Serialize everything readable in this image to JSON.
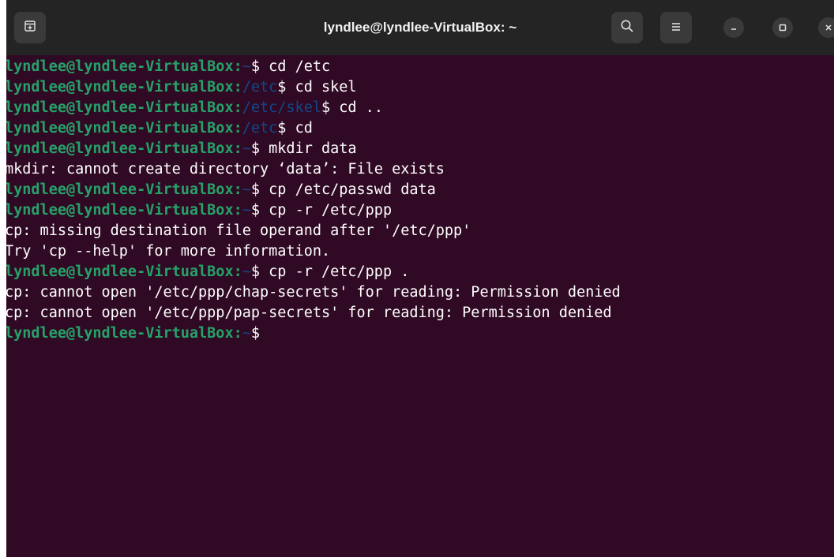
{
  "window": {
    "title": "lyndlee@lyndlee-VirtualBox: ~"
  },
  "icons": {
    "new_tab": "new-tab-icon",
    "search": "search-icon",
    "menu": "hamburger-menu-icon",
    "minimize": "minimize-icon",
    "maximize": "maximize-icon",
    "close": "close-icon"
  },
  "colors": {
    "terminal_bg": "#300a24",
    "titlebar_bg": "#242424",
    "prompt_user": "#26a269",
    "prompt_path": "#12488b",
    "text": "#ffffff"
  },
  "terminal": {
    "lines": [
      {
        "type": "cmd",
        "user": "lyndlee@lyndlee-VirtualBox",
        "sep": ":",
        "path": "~",
        "dollar": "$ ",
        "cmd": "cd /etc"
      },
      {
        "type": "cmd",
        "user": "lyndlee@lyndlee-VirtualBox",
        "sep": ":",
        "path": "/etc",
        "dollar": "$ ",
        "cmd": "cd skel"
      },
      {
        "type": "cmd",
        "user": "lyndlee@lyndlee-VirtualBox",
        "sep": ":",
        "path": "/etc/skel",
        "dollar": "$ ",
        "cmd": "cd .."
      },
      {
        "type": "cmd",
        "user": "lyndlee@lyndlee-VirtualBox",
        "sep": ":",
        "path": "/etc",
        "dollar": "$ ",
        "cmd": "cd"
      },
      {
        "type": "cmd",
        "user": "lyndlee@lyndlee-VirtualBox",
        "sep": ":",
        "path": "~",
        "dollar": "$ ",
        "cmd": "mkdir data"
      },
      {
        "type": "out",
        "text": "mkdir: cannot create directory ‘data’: File exists"
      },
      {
        "type": "cmd",
        "user": "lyndlee@lyndlee-VirtualBox",
        "sep": ":",
        "path": "~",
        "dollar": "$ ",
        "cmd": "cp /etc/passwd data"
      },
      {
        "type": "cmd",
        "user": "lyndlee@lyndlee-VirtualBox",
        "sep": ":",
        "path": "~",
        "dollar": "$ ",
        "cmd": "cp -r /etc/ppp"
      },
      {
        "type": "out",
        "text": "cp: missing destination file operand after '/etc/ppp'"
      },
      {
        "type": "out",
        "text": "Try 'cp --help' for more information."
      },
      {
        "type": "cmd",
        "user": "lyndlee@lyndlee-VirtualBox",
        "sep": ":",
        "path": "~",
        "dollar": "$ ",
        "cmd": "cp -r /etc/ppp ."
      },
      {
        "type": "out",
        "text": "cp: cannot open '/etc/ppp/chap-secrets' for reading: Permission denied"
      },
      {
        "type": "out",
        "text": "cp: cannot open '/etc/ppp/pap-secrets' for reading: Permission denied"
      },
      {
        "type": "cmd",
        "user": "lyndlee@lyndlee-VirtualBox",
        "sep": ":",
        "path": "~",
        "dollar": "$",
        "cmd": ""
      }
    ]
  }
}
